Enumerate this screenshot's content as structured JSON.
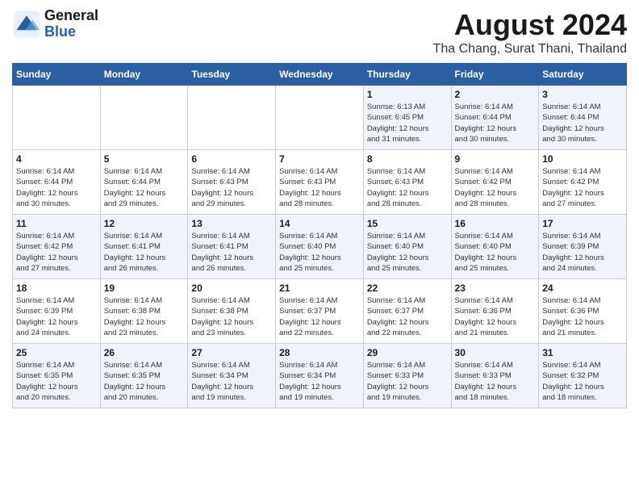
{
  "logo": {
    "line1": "General",
    "line2": "Blue"
  },
  "title": "August 2024",
  "location": "Tha Chang, Surat Thani, Thailand",
  "days_of_week": [
    "Sunday",
    "Monday",
    "Tuesday",
    "Wednesday",
    "Thursday",
    "Friday",
    "Saturday"
  ],
  "weeks": [
    [
      {
        "day": "",
        "info": ""
      },
      {
        "day": "",
        "info": ""
      },
      {
        "day": "",
        "info": ""
      },
      {
        "day": "",
        "info": ""
      },
      {
        "day": "1",
        "info": "Sunrise: 6:13 AM\nSunset: 6:45 PM\nDaylight: 12 hours\nand 31 minutes."
      },
      {
        "day": "2",
        "info": "Sunrise: 6:14 AM\nSunset: 6:44 PM\nDaylight: 12 hours\nand 30 minutes."
      },
      {
        "day": "3",
        "info": "Sunrise: 6:14 AM\nSunset: 6:44 PM\nDaylight: 12 hours\nand 30 minutes."
      }
    ],
    [
      {
        "day": "4",
        "info": "Sunrise: 6:14 AM\nSunset: 6:44 PM\nDaylight: 12 hours\nand 30 minutes."
      },
      {
        "day": "5",
        "info": "Sunrise: 6:14 AM\nSunset: 6:44 PM\nDaylight: 12 hours\nand 29 minutes."
      },
      {
        "day": "6",
        "info": "Sunrise: 6:14 AM\nSunset: 6:43 PM\nDaylight: 12 hours\nand 29 minutes."
      },
      {
        "day": "7",
        "info": "Sunrise: 6:14 AM\nSunset: 6:43 PM\nDaylight: 12 hours\nand 28 minutes."
      },
      {
        "day": "8",
        "info": "Sunrise: 6:14 AM\nSunset: 6:43 PM\nDaylight: 12 hours\nand 28 minutes."
      },
      {
        "day": "9",
        "info": "Sunrise: 6:14 AM\nSunset: 6:42 PM\nDaylight: 12 hours\nand 28 minutes."
      },
      {
        "day": "10",
        "info": "Sunrise: 6:14 AM\nSunset: 6:42 PM\nDaylight: 12 hours\nand 27 minutes."
      }
    ],
    [
      {
        "day": "11",
        "info": "Sunrise: 6:14 AM\nSunset: 6:42 PM\nDaylight: 12 hours\nand 27 minutes."
      },
      {
        "day": "12",
        "info": "Sunrise: 6:14 AM\nSunset: 6:41 PM\nDaylight: 12 hours\nand 26 minutes."
      },
      {
        "day": "13",
        "info": "Sunrise: 6:14 AM\nSunset: 6:41 PM\nDaylight: 12 hours\nand 26 minutes."
      },
      {
        "day": "14",
        "info": "Sunrise: 6:14 AM\nSunset: 6:40 PM\nDaylight: 12 hours\nand 25 minutes."
      },
      {
        "day": "15",
        "info": "Sunrise: 6:14 AM\nSunset: 6:40 PM\nDaylight: 12 hours\nand 25 minutes."
      },
      {
        "day": "16",
        "info": "Sunrise: 6:14 AM\nSunset: 6:40 PM\nDaylight: 12 hours\nand 25 minutes."
      },
      {
        "day": "17",
        "info": "Sunrise: 6:14 AM\nSunset: 6:39 PM\nDaylight: 12 hours\nand 24 minutes."
      }
    ],
    [
      {
        "day": "18",
        "info": "Sunrise: 6:14 AM\nSunset: 6:39 PM\nDaylight: 12 hours\nand 24 minutes."
      },
      {
        "day": "19",
        "info": "Sunrise: 6:14 AM\nSunset: 6:38 PM\nDaylight: 12 hours\nand 23 minutes."
      },
      {
        "day": "20",
        "info": "Sunrise: 6:14 AM\nSunset: 6:38 PM\nDaylight: 12 hours\nand 23 minutes."
      },
      {
        "day": "21",
        "info": "Sunrise: 6:14 AM\nSunset: 6:37 PM\nDaylight: 12 hours\nand 22 minutes."
      },
      {
        "day": "22",
        "info": "Sunrise: 6:14 AM\nSunset: 6:37 PM\nDaylight: 12 hours\nand 22 minutes."
      },
      {
        "day": "23",
        "info": "Sunrise: 6:14 AM\nSunset: 6:36 PM\nDaylight: 12 hours\nand 21 minutes."
      },
      {
        "day": "24",
        "info": "Sunrise: 6:14 AM\nSunset: 6:36 PM\nDaylight: 12 hours\nand 21 minutes."
      }
    ],
    [
      {
        "day": "25",
        "info": "Sunrise: 6:14 AM\nSunset: 6:35 PM\nDaylight: 12 hours\nand 20 minutes."
      },
      {
        "day": "26",
        "info": "Sunrise: 6:14 AM\nSunset: 6:35 PM\nDaylight: 12 hours\nand 20 minutes."
      },
      {
        "day": "27",
        "info": "Sunrise: 6:14 AM\nSunset: 6:34 PM\nDaylight: 12 hours\nand 19 minutes."
      },
      {
        "day": "28",
        "info": "Sunrise: 6:14 AM\nSunset: 6:34 PM\nDaylight: 12 hours\nand 19 minutes."
      },
      {
        "day": "29",
        "info": "Sunrise: 6:14 AM\nSunset: 6:33 PM\nDaylight: 12 hours\nand 19 minutes."
      },
      {
        "day": "30",
        "info": "Sunrise: 6:14 AM\nSunset: 6:33 PM\nDaylight: 12 hours\nand 18 minutes."
      },
      {
        "day": "31",
        "info": "Sunrise: 6:14 AM\nSunset: 6:32 PM\nDaylight: 12 hours\nand 18 minutes."
      }
    ]
  ]
}
